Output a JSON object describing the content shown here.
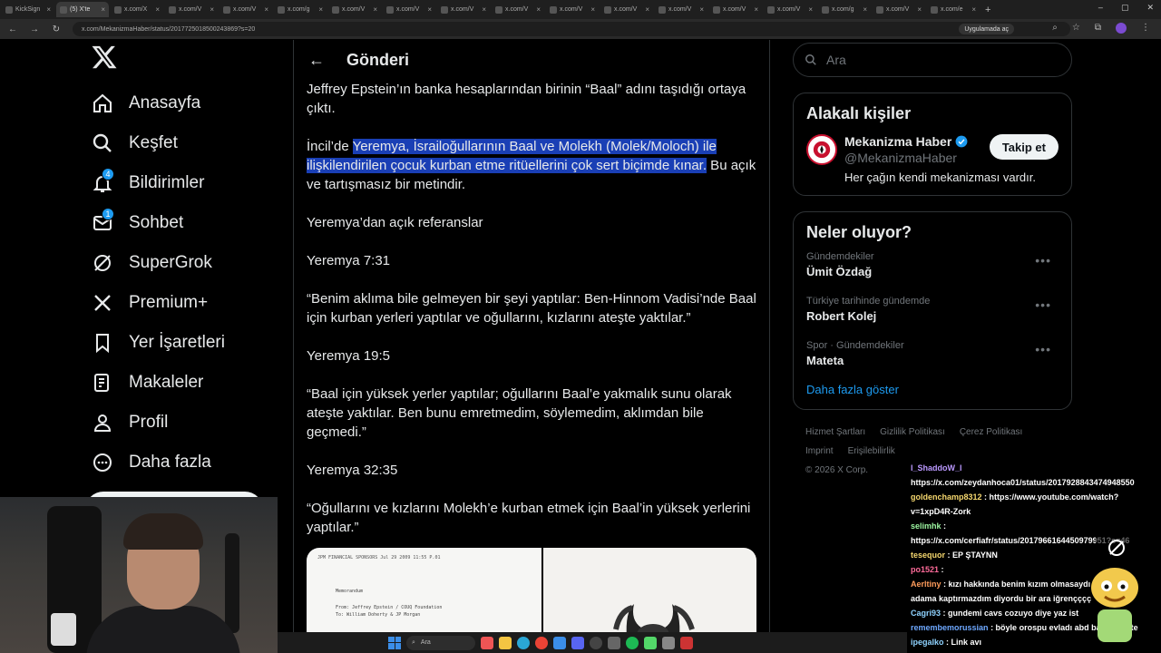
{
  "browser": {
    "tabs": [
      {
        "label": "KickSign"
      },
      {
        "label": "(5) X'te"
      },
      {
        "label": "x.com/X"
      },
      {
        "label": "x.com/V"
      },
      {
        "label": "x.com/V"
      },
      {
        "label": "x.com/g"
      },
      {
        "label": "x.com/V"
      },
      {
        "label": "x.com/V"
      },
      {
        "label": "x.com/V"
      },
      {
        "label": "x.com/V"
      },
      {
        "label": "x.com/V"
      },
      {
        "label": "x.com/V"
      },
      {
        "label": "x.com/V"
      },
      {
        "label": "x.com/V"
      },
      {
        "label": "x.com/V"
      },
      {
        "label": "x.com/g"
      },
      {
        "label": "x.com/V"
      },
      {
        "label": "x.com/e"
      }
    ],
    "url": "x.com/MekanizmaHaber/status/2017725018500243869?s=20",
    "open_app_label": "Uygulamada aç"
  },
  "nav": {
    "items": [
      {
        "label": "Anasayfa",
        "icon": "home-icon"
      },
      {
        "label": "Keşfet",
        "icon": "search-icon"
      },
      {
        "label": "Bildirimler",
        "icon": "bell-icon",
        "badge": "4"
      },
      {
        "label": "Sohbet",
        "icon": "mail-icon",
        "badge": "1"
      },
      {
        "label": "SuperGrok",
        "icon": "grok-icon"
      },
      {
        "label": "Premium+",
        "icon": "x-logo-icon"
      },
      {
        "label": "Yer İşaretleri",
        "icon": "bookmark-icon"
      },
      {
        "label": "Makaleler",
        "icon": "article-icon"
      },
      {
        "label": "Profil",
        "icon": "person-icon"
      },
      {
        "label": "Daha fazla",
        "icon": "more-circle-icon"
      }
    ]
  },
  "main": {
    "title": "Gönderi",
    "para1": "Jeffrey Epstein’ın banka hesaplarından birinin “Baal” adını taşıdığı ortaya çıktı.",
    "para2_pre": "İncil’de ",
    "para2_hl": "Yeremya, İsrailoğullarının Baal ve Molekh (Molek/Moloch) ile ilişkilendirilen çocuk kurban etme ritüellerini çok sert biçimde kınar.",
    "para2_post": " Bu açık ve tartışmasız bir metindir.",
    "para3": "Yeremya’dan açık referanslar",
    "para4": "Yeremya 7:31",
    "para5": "“Benim aklıma bile gelmeyen bir şeyi yaptılar: Ben-Hinnom Vadisi’nde Baal için kurban yerleri yaptılar ve oğullarını, kızlarını ateşte yaktılar.”",
    "para6": "Yeremya 19:5",
    "para7": "“Baal için yüksek yerler yaptılar; oğullarını Baal’e yakmalık sunu olarak ateşte yaktılar. Ben bunu emretmedim, söylemedim, aklımdan bile geçmedi.”",
    "para8": "Yeremya 32:35",
    "para9": "“Oğullarını ve kızlarını Molekh’e kurban etmek için Baal’in yüksek yerlerini yaptılar.”",
    "doc_header": "JPM FINANCIAL SPONSORS   Jul 29 2009 11:55 P.01",
    "doc_memo": "Memorandum",
    "doc_from": "From: Jeffrey Epstein / COUQ Foundation",
    "doc_to": "To: William Doherty & JP Morgan"
  },
  "right": {
    "search_placeholder": "Ara",
    "related_title": "Alakalı kişiler",
    "person": {
      "name": "Mekanizma Haber",
      "handle": "@MekanizmaHaber",
      "bio": "Her çağın kendi mekanizması vardır.",
      "follow_label": "Takip et"
    },
    "trends_title": "Neler oluyor?",
    "trends": [
      {
        "category": "Gündemdekiler",
        "name": "Ümit Özdağ"
      },
      {
        "category": "Türkiye tarihinde gündemde",
        "name": "Robert Kolej"
      },
      {
        "category": "Spor · Gündemdekiler",
        "name": "Mateta"
      }
    ],
    "show_more": "Daha fazla göster",
    "footer": {
      "line1": [
        "Hizmet Şartları",
        "Gizlilik Politikası",
        "Çerez Politikası"
      ],
      "line2": [
        "Imprint",
        "Erişilebilirlik"
      ],
      "copyright": "© 2026 X Corp."
    }
  },
  "chat": [
    {
      "user": "l_ShaddoW_l",
      "text": "",
      "user_color": "#b9f",
      "text_color": "#fff"
    },
    {
      "user": "",
      "text": "https://x.com/zeydanhoca01/status/2017928843474948550",
      "user_color": "#fff",
      "text_color": "#fff"
    },
    {
      "user": "goldenchamp8312",
      "text": ": https://www.youtube.com/watch?",
      "user_color": "#f5d76e",
      "text_color": "#fff"
    },
    {
      "user": "",
      "text": "v=1xpD4R-Zork",
      "user_color": "#fff",
      "text_color": "#fff"
    },
    {
      "user": "selimhk",
      "text": ":",
      "user_color": "#9cf5a0",
      "text_color": "#fff"
    },
    {
      "user": "",
      "text": "https://x.com/cerfiafr/status/2017966164450979951?s=46",
      "user_color": "#fff",
      "text_color": "#fff"
    },
    {
      "user": "tesequor",
      "text": ": EP ŞTAYNN",
      "user_color": "#f5d76e",
      "text_color": "#fff"
    },
    {
      "user": "po1521",
      "text": ":",
      "user_color": "#ff6b9a",
      "text_color": "#fff"
    },
    {
      "user": "Aerltiny",
      "text": ": kızı hakkında benim kızım olmasaydı başka bir",
      "user_color": "#ff9c5b",
      "text_color": "#fff"
    },
    {
      "user": "",
      "text": "adama kaptırmazdım diyordu bir ara iğrençççç",
      "user_color": "#fff",
      "text_color": "#fff"
    },
    {
      "user": "Cagri93",
      "text": ": gundemi cavs cozuyo diye yaz ist",
      "user_color": "#8fd3ff",
      "text_color": "#fff"
    },
    {
      "user": "remembemorussian",
      "text": ": böyle orospu evladı abd başkanı iste",
      "user_color": "#6ea8ff",
      "text_color": "#fff"
    },
    {
      "user": "ipegalko",
      "text": ": Link avı",
      "user_color": "#8fd3ff",
      "text_color": "#fff"
    }
  ],
  "taskbar": {
    "search_label": "Ara"
  },
  "colors": {
    "accent": "#1d9bf0",
    "highlight": "#1a3fb5",
    "background": "#000000"
  }
}
